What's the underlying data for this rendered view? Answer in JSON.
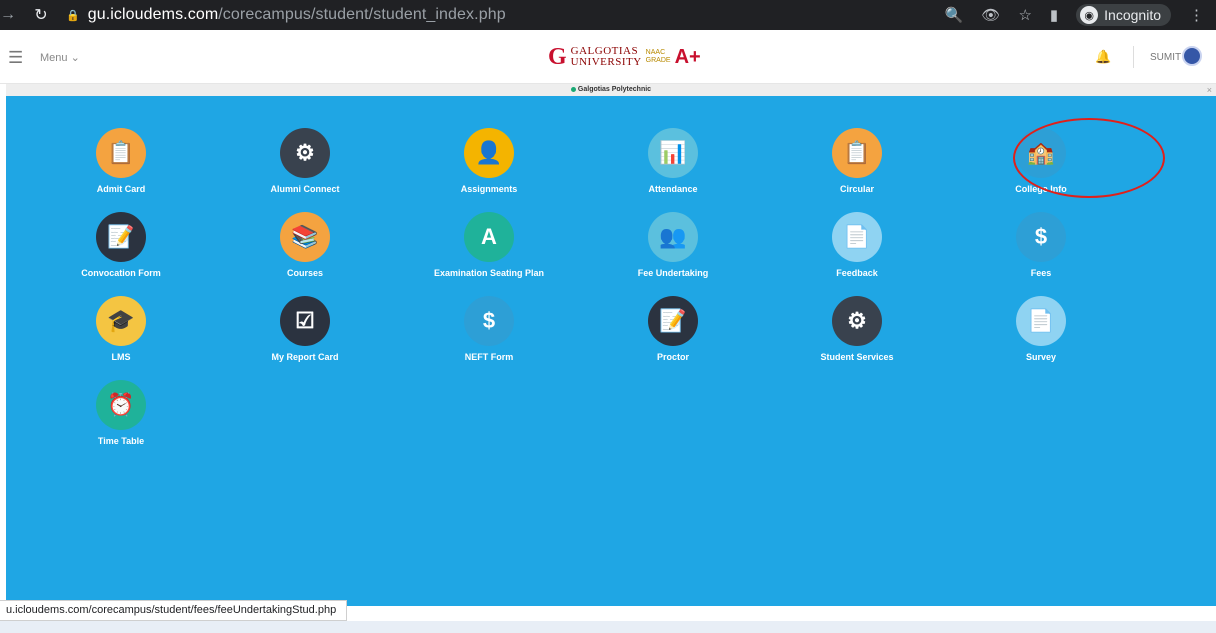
{
  "browser": {
    "url_host": "gu.icloudems.com",
    "url_path": "/corecampus/student/student_index.php",
    "incognito_label": "Incognito"
  },
  "header": {
    "menu_label": "Menu",
    "user_name": "SUMIT",
    "logo": {
      "brand": "GALGOTIAS",
      "sub": "UNIVERSITY",
      "naac": "NAAC",
      "grade_label": "GRADE",
      "grade": "A+"
    }
  },
  "institute_strip": {
    "name": "Galgotias Polytechnic"
  },
  "tiles": [
    {
      "label": "Admit Card",
      "icon": "admit-card-icon",
      "glyph": "📋",
      "color": "#f4a340"
    },
    {
      "label": "Alumni Connect",
      "icon": "gears-icon",
      "glyph": "⚙",
      "color": "#39424e"
    },
    {
      "label": "Assignments",
      "icon": "student-laptop-icon",
      "glyph": "👤",
      "color": "#f4b400"
    },
    {
      "label": "Attendance",
      "icon": "presentation-icon",
      "glyph": "📊",
      "color": "#5bc0de"
    },
    {
      "label": "Circular",
      "icon": "clipboard-icon",
      "glyph": "📋",
      "color": "#f4a340"
    },
    {
      "label": "College Info",
      "icon": "college-building-icon",
      "glyph": "🏫",
      "color": "#2d9fd6"
    },
    {
      "label": "Convocation Form",
      "icon": "form-edit-icon",
      "glyph": "📝",
      "color": "#2b3340"
    },
    {
      "label": "Courses",
      "icon": "books-icon",
      "glyph": "📚",
      "color": "#f4a340"
    },
    {
      "label": "Examination Seating Plan",
      "icon": "exam-grade-icon",
      "glyph": "A",
      "color": "#1fb29a"
    },
    {
      "label": "Fee Undertaking",
      "icon": "people-group-icon",
      "glyph": "👥",
      "color": "#5bc0de"
    },
    {
      "label": "Feedback",
      "icon": "feedback-doc-icon",
      "glyph": "📄",
      "color": "#8fd3f2"
    },
    {
      "label": "Fees",
      "icon": "fees-money-icon",
      "glyph": "$",
      "color": "#2d9fd6"
    },
    {
      "label": "LMS",
      "icon": "graduation-books-icon",
      "glyph": "🎓",
      "color": "#f4c542"
    },
    {
      "label": "My Report Card",
      "icon": "checklist-icon",
      "glyph": "☑",
      "color": "#2b3340"
    },
    {
      "label": "NEFT Form",
      "icon": "money-transfer-icon",
      "glyph": "$",
      "color": "#2d9fd6"
    },
    {
      "label": "Proctor",
      "icon": "form-edit-icon",
      "glyph": "📝",
      "color": "#2b3340"
    },
    {
      "label": "Student Services",
      "icon": "gears-icon",
      "glyph": "⚙",
      "color": "#39424e"
    },
    {
      "label": "Survey",
      "icon": "survey-doc-icon",
      "glyph": "📄",
      "color": "#8fd3f2"
    },
    {
      "label": "Time Table",
      "icon": "alarm-clock-icon",
      "glyph": "⏰",
      "color": "#1fb29a"
    }
  ],
  "status_url": "u.icloudems.com/corecampus/student/fees/feeUndertakingStud.php"
}
